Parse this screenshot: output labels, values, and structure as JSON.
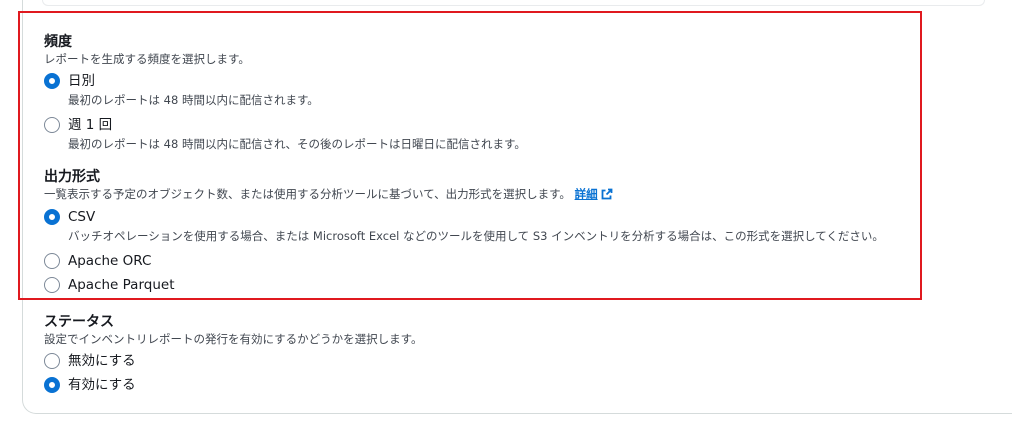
{
  "frequency": {
    "title": "頻度",
    "description": "レポートを生成する頻度を選択します。",
    "options": [
      {
        "label": "日別",
        "description": "最初のレポートは 48 時間以内に配信されます。",
        "selected": true
      },
      {
        "label": "週 1 回",
        "description": "最初のレポートは 48 時間以内に配信され、その後のレポートは日曜日に配信されます。",
        "selected": false
      }
    ]
  },
  "output_format": {
    "title": "出力形式",
    "description": "一覧表示する予定のオブジェクト数、または使用する分析ツールに基づいて、出力形式を選択します。",
    "details_link": "詳細",
    "details_icon": "external-link-icon",
    "options": [
      {
        "label": "CSV",
        "description": "バッチオペレーションを使用する場合、または Microsoft Excel などのツールを使用して S3 インベントリを分析する場合は、この形式を選択してください。",
        "selected": true
      },
      {
        "label": "Apache ORC",
        "selected": false
      },
      {
        "label": "Apache Parquet",
        "selected": false
      }
    ]
  },
  "status": {
    "title": "ステータス",
    "description": "設定でインベントリレポートの発行を有効にするかどうかを選択します。",
    "options": [
      {
        "label": "無効にする",
        "selected": false
      },
      {
        "label": "有効にする",
        "selected": true
      }
    ]
  },
  "colors": {
    "accent": "#0972d3",
    "highlight_border": "#e0191f"
  }
}
